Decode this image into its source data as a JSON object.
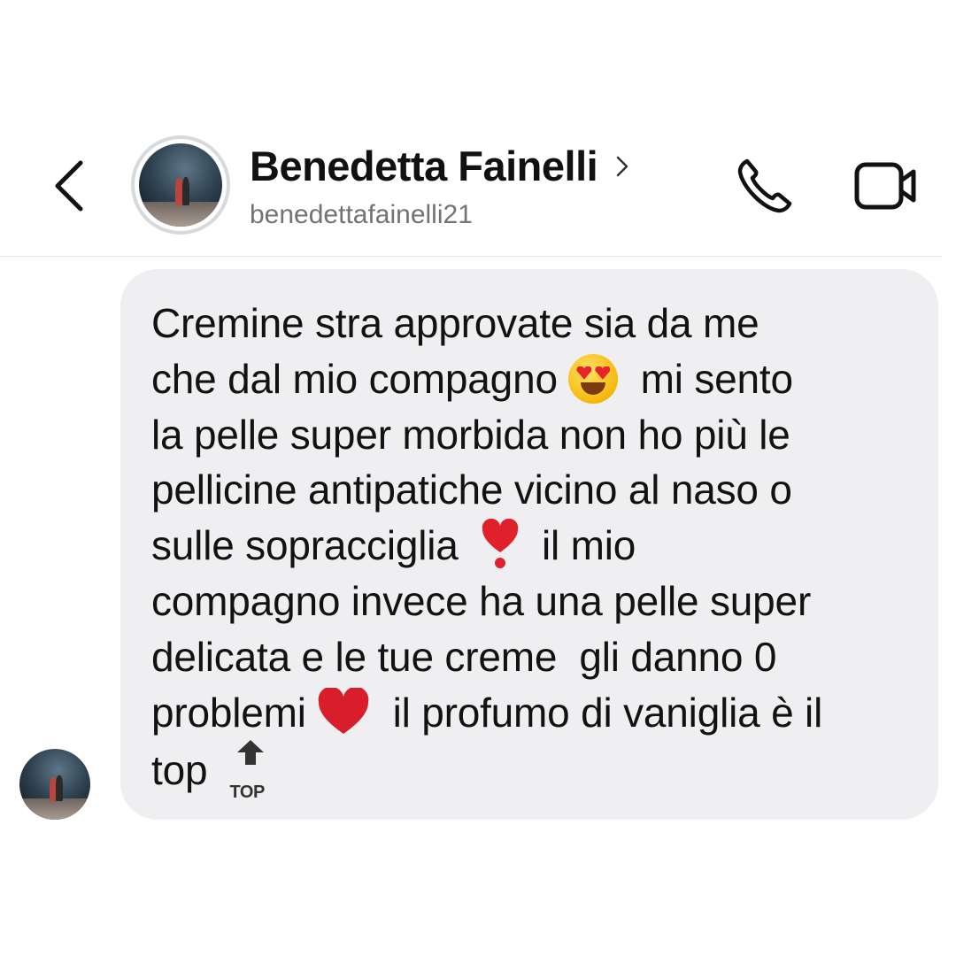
{
  "contact": {
    "name": "Benedetta Fainelli",
    "username": "benedettafainelli21"
  },
  "icons": {
    "back": "chevron-left-icon",
    "profile": "chevron-right-icon",
    "call": "phone-icon",
    "video": "video-camera-icon"
  },
  "message": {
    "line1": "Cremine stra approvate sia da me",
    "line2a": "che dal mio compagno",
    "line2b": "mi sento",
    "line3": "la pelle super morbida non ho più le",
    "line4": "pellicine antipatiche vicino al naso o",
    "line5a": "sulle sopracciglia",
    "line5b": "il mio",
    "line6": "compagno invece ha una pelle super",
    "line7": "delicata e le tue creme  gli danno 0",
    "line8a": "problemi",
    "line8b": "il profumo di vaniglia è il",
    "line9": "top",
    "top_emoji_label": "TOP"
  },
  "colors": {
    "bubble": "#efeff1",
    "heart": "#d81e2a"
  }
}
